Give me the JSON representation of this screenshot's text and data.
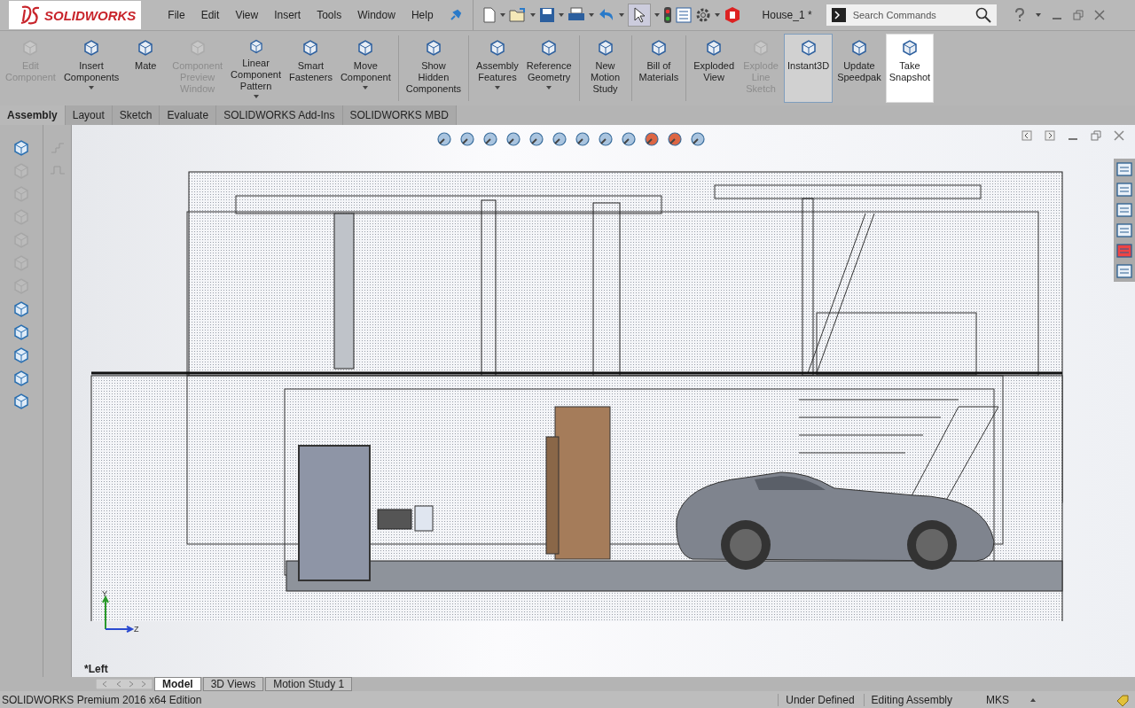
{
  "app": {
    "logo": "SOLIDWORKS",
    "menu": [
      "File",
      "Edit",
      "View",
      "Insert",
      "Tools",
      "Window",
      "Help"
    ],
    "document_title": "House_1 *"
  },
  "search": {
    "placeholder": "Search Commands"
  },
  "ribbon": {
    "groups": [
      {
        "buttons": [
          {
            "label": "Edit Component",
            "disabled": true,
            "dropdown": false,
            "selected": false,
            "highlighted": false
          },
          {
            "label": "Insert Components",
            "disabled": false,
            "dropdown": true,
            "selected": false,
            "highlighted": false
          },
          {
            "label": "Mate",
            "disabled": false,
            "dropdown": false,
            "selected": false,
            "highlighted": false
          },
          {
            "label": "Component Preview Window",
            "disabled": true,
            "dropdown": false,
            "selected": false,
            "highlighted": false
          },
          {
            "label": "Linear Component Pattern",
            "disabled": false,
            "dropdown": true,
            "selected": false,
            "highlighted": false
          },
          {
            "label": "Smart Fasteners",
            "disabled": false,
            "dropdown": false,
            "selected": false,
            "highlighted": false
          },
          {
            "label": "Move Component",
            "disabled": false,
            "dropdown": true,
            "selected": false,
            "highlighted": false
          }
        ]
      },
      {
        "buttons": [
          {
            "label": "Show Hidden Components",
            "disabled": false,
            "dropdown": false,
            "selected": false,
            "highlighted": false
          }
        ]
      },
      {
        "buttons": [
          {
            "label": "Assembly Features",
            "disabled": false,
            "dropdown": true,
            "selected": false,
            "highlighted": false
          },
          {
            "label": "Reference Geometry",
            "disabled": false,
            "dropdown": true,
            "selected": false,
            "highlighted": false
          }
        ]
      },
      {
        "buttons": [
          {
            "label": "New Motion Study",
            "disabled": false,
            "dropdown": false,
            "selected": false,
            "highlighted": false
          }
        ]
      },
      {
        "buttons": [
          {
            "label": "Bill of Materials",
            "disabled": false,
            "dropdown": false,
            "selected": false,
            "highlighted": false
          }
        ]
      },
      {
        "buttons": [
          {
            "label": "Exploded View",
            "disabled": false,
            "dropdown": false,
            "selected": false,
            "highlighted": false
          },
          {
            "label": "Explode Line Sketch",
            "disabled": true,
            "dropdown": false,
            "selected": false,
            "highlighted": false
          },
          {
            "label": "Instant3D",
            "disabled": false,
            "dropdown": false,
            "selected": true,
            "highlighted": false
          },
          {
            "label": "Update Speedpak",
            "disabled": false,
            "dropdown": false,
            "selected": false,
            "highlighted": false
          },
          {
            "label": "Take Snapshot",
            "disabled": false,
            "dropdown": false,
            "selected": false,
            "highlighted": true
          }
        ]
      }
    ]
  },
  "command_tabs": [
    {
      "label": "Assembly",
      "selected": true
    },
    {
      "label": "Layout",
      "selected": false
    },
    {
      "label": "Sketch",
      "selected": false
    },
    {
      "label": "Evaluate",
      "selected": false
    },
    {
      "label": "SOLIDWORKS Add-Ins",
      "selected": false
    },
    {
      "label": "SOLIDWORKS MBD",
      "selected": false
    }
  ],
  "left_toolbar": [
    {
      "disabled": false
    },
    {
      "disabled": true
    },
    {
      "disabled": true
    },
    {
      "disabled": true
    },
    {
      "disabled": true
    },
    {
      "disabled": true
    },
    {
      "disabled": true
    },
    {
      "disabled": false
    },
    {
      "disabled": false
    },
    {
      "disabled": false
    },
    {
      "disabled": false
    },
    {
      "disabled": false
    }
  ],
  "viewport": {
    "view_name": "*Left",
    "triad_labels": [
      "Y",
      "Z"
    ]
  },
  "bottom_tabs": [
    {
      "label": "Model",
      "selected": true
    },
    {
      "label": "3D Views",
      "selected": false
    },
    {
      "label": "Motion Study 1",
      "selected": false
    }
  ],
  "status_bar": {
    "edition": "SOLIDWORKS Premium 2016 x64 Edition",
    "definition": "Under Defined",
    "mode": "Editing Assembly",
    "units": "MKS"
  }
}
